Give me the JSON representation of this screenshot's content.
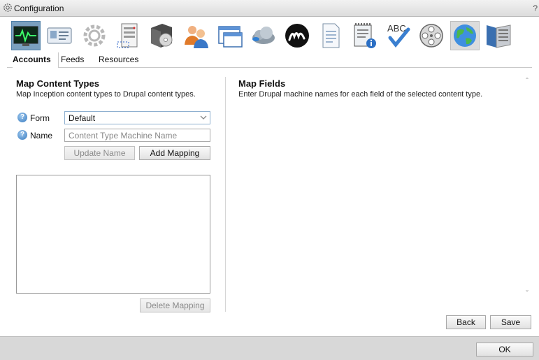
{
  "window": {
    "title": "Configuration",
    "help": "?"
  },
  "toolbar": {
    "icons": [
      "monitor-icon",
      "id-card-icon",
      "gear-icon",
      "server-list-icon",
      "software-box-icon",
      "users-icon",
      "window-icon",
      "cloud-icon",
      "m-logo-icon",
      "document-icon",
      "notepad-info-icon",
      "spellcheck-icon",
      "film-reel-icon",
      "globe-icon",
      "network-server-icon"
    ]
  },
  "tabs": [
    {
      "label": "Accounts"
    },
    {
      "label": "Feeds"
    },
    {
      "label": "Resources"
    }
  ],
  "left": {
    "title": "Map Content Types",
    "subtitle": "Map Inception content types to Drupal content types.",
    "form_label": "Form",
    "form_value": "Default",
    "name_label": "Name",
    "name_placeholder": "Content Type Machine Name",
    "name_value": "",
    "update_button": "Update Name",
    "add_button": "Add Mapping",
    "delete_button": "Delete Mapping"
  },
  "right": {
    "title": "Map Fields",
    "subtitle": "Enter Drupal machine names for each field of the selected content type."
  },
  "actions": {
    "back": "Back",
    "save": "Save"
  },
  "footer": {
    "ok": "OK"
  },
  "colors": {
    "active_icon_bg": "#7aa0bf",
    "footer_bg": "#d8d8d8",
    "help_blue": "#3a7cc0"
  }
}
